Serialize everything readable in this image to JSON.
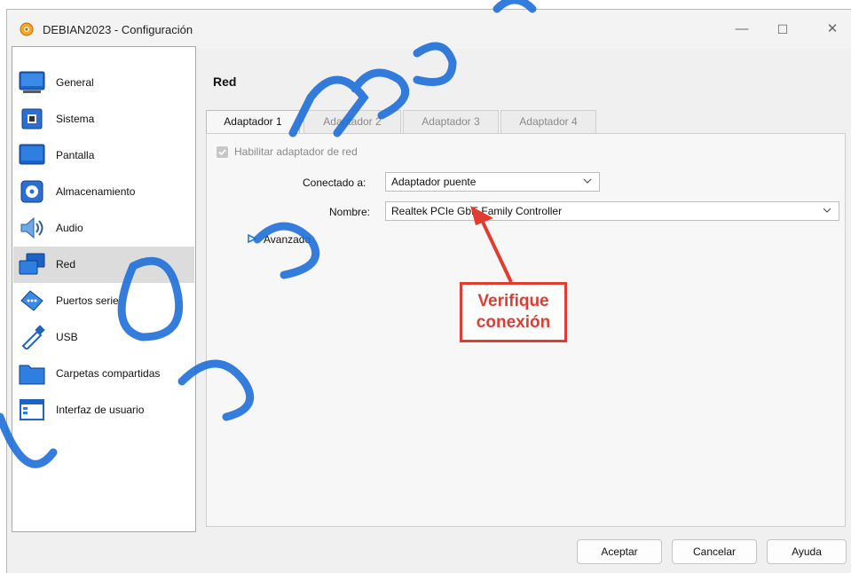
{
  "window": {
    "title": "DEBIAN2023 - Configuración",
    "minimize_glyph": "—",
    "maximize_glyph": "☐",
    "close_glyph": "✕"
  },
  "sidebar": {
    "items": [
      {
        "label": "General",
        "icon": "monitor-icon"
      },
      {
        "label": "Sistema",
        "icon": "chip-icon"
      },
      {
        "label": "Pantalla",
        "icon": "display-icon"
      },
      {
        "label": "Almacenamiento",
        "icon": "storage-icon"
      },
      {
        "label": "Audio",
        "icon": "speaker-icon"
      },
      {
        "label": "Red",
        "icon": "network-icon",
        "selected": true
      },
      {
        "label": "Puertos serie",
        "icon": "serial-port-icon"
      },
      {
        "label": "USB",
        "icon": "usb-icon"
      },
      {
        "label": "Carpetas compartidas",
        "icon": "folder-icon"
      },
      {
        "label": "Interfaz de usuario",
        "icon": "window-icon"
      }
    ]
  },
  "main": {
    "section_title": "Red",
    "tabs": [
      {
        "label": "Adaptador 1",
        "active": true
      },
      {
        "label": "Adaptador 2",
        "active": false
      },
      {
        "label": "Adaptador 3",
        "active": false
      },
      {
        "label": "Adaptador 4",
        "active": false
      }
    ],
    "enable_checkbox_label": "Habilitar adaptador de red",
    "connected_to_label": "Conectado a:",
    "connected_to_value": "Adaptador puente",
    "name_label": "Nombre:",
    "name_value": "Realtek PCIe GbE Family Controller",
    "advanced_label": "Avanzado"
  },
  "annotation": {
    "line1": "Verifique",
    "line2": "conexión",
    "color": "#e03c31"
  },
  "buttons": {
    "accept": "Aceptar",
    "cancel": "Cancelar",
    "help": "Ayuda"
  },
  "colors": {
    "selected_bg": "#dcdcdc",
    "accent_blue": "#1e78d6",
    "watermark_blue": "#1e6fd9"
  }
}
